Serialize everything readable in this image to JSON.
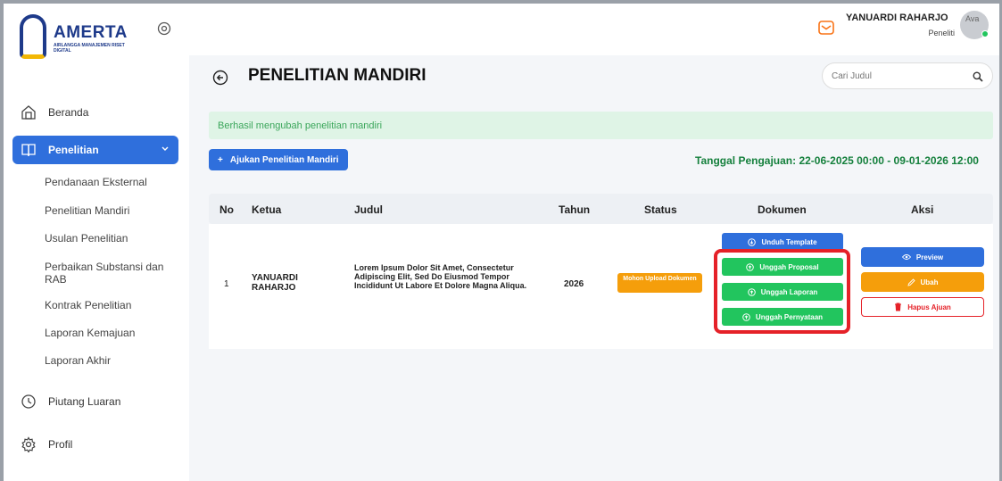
{
  "brand": {
    "name": "AMERTA",
    "subtitle": "AIRLANGGA MANAJEMEN RISET DIGITAL"
  },
  "sidebar": {
    "items": [
      {
        "label": "Beranda",
        "icon": "home-icon"
      },
      {
        "label": "Penelitian",
        "icon": "book-icon",
        "active": true
      },
      {
        "label": "Piutang Luaran",
        "icon": "clock-icon"
      },
      {
        "label": "Profil",
        "icon": "gear-icon"
      }
    ],
    "sub_items": [
      "Pendanaan Eksternal",
      "Penelitian Mandiri",
      "Usulan Penelitian",
      "Perbaikan Substansi dan RAB",
      "Kontrak Penelitian",
      "Laporan Kemajuan",
      "Laporan Akhir"
    ]
  },
  "topbar": {
    "user_name": "YANUARDI RAHARJO",
    "user_role": "Peneliti",
    "avatar_alt": "Ava"
  },
  "main": {
    "title": "PENELITIAN MANDIRI",
    "search_placeholder": "Cari Judul",
    "alert": "Berhasil mengubah penelitian mandiri",
    "ajukan_label": "Ajukan Penelitian Mandiri",
    "tanggal": "Tanggal Pengajuan: 22-06-2025 00:00 - 09-01-2026 12:00"
  },
  "table": {
    "headers": [
      "No",
      "Ketua",
      "Judul",
      "Tahun",
      "Status",
      "Dokumen",
      "Aksi"
    ],
    "rows": [
      {
        "no": "1",
        "ketua": "YANUARDI RAHARJO",
        "judul": "Lorem Ipsum Dolor Sit Amet, Consectetur Adipiscing Elit, Sed Do Eiusmod Tempor Incididunt Ut Labore Et Dolore Magna Aliqua.",
        "tahun": "2026",
        "status": "Mohon Upload Dokumen",
        "dokumen": [
          "Unduh Template",
          "Unggah Proposal",
          "Unggah Laporan",
          "Unggah Pernyataan"
        ],
        "aksi": [
          "Preview",
          "Ubah",
          "Hapus Ajuan"
        ]
      }
    ]
  },
  "colors": {
    "primary": "#2f6fdc",
    "success": "#22c55e",
    "warning": "#f59e0b",
    "danger": "#e52128",
    "highlight": "#e52128"
  }
}
